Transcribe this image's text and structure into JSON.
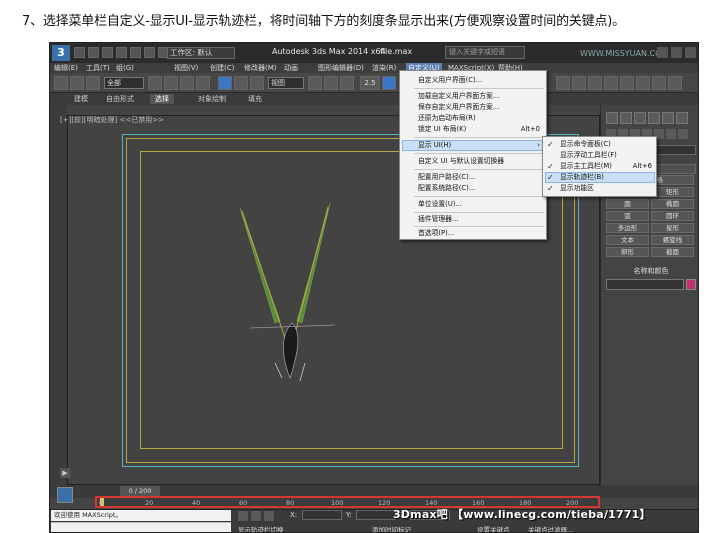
{
  "instruction": "7、选择菜单栏自定义-显示UI-显示轨迹栏，将时间轴下方的刻度条显示出来(方便观察设置时间的关键点)。",
  "titlebar": {
    "logo_text": "3",
    "workspace_label": "工作区: 默认",
    "app_title": "Autodesk 3ds Max  2014 x64",
    "file_name": "file.max",
    "search_placeholder": "键入关键字或短语",
    "site_watermark": "WWW.MISSYUAN.COM"
  },
  "menubar": {
    "items": [
      "编辑(E)",
      "工具(T)",
      "组(G)",
      "视图(V)",
      "创建(C)",
      "修改器(M)",
      "动画",
      "图形编辑器(D)",
      "渲染(R)",
      "自定义(U)",
      "MAXScript(X)",
      "帮助(H)"
    ]
  },
  "toolbar": {
    "selection_filter": "全部",
    "view_dropdown": "视图",
    "snap_label": "2.5"
  },
  "ribbon": {
    "tabs": [
      "建模",
      "自由形式",
      "选择",
      "对象绘制",
      "填充"
    ]
  },
  "viewport": {
    "label": "[+][前][明暗处理] <<已禁用>>",
    "play_symbol": "▶"
  },
  "customize_menu": {
    "items": [
      {
        "label": "自定义用户界面(C)..."
      },
      {
        "label": "加载自定义用户界面方案..."
      },
      {
        "label": "保存自定义用户界面方案..."
      },
      {
        "label": "还原为启动布局(R)"
      },
      {
        "label": "锁定 UI 布局(K)",
        "shortcut": "Alt+0"
      },
      {
        "label": "显示 UI(H)",
        "arrow": "›"
      },
      {
        "label": "自定义 UI 与默认设置切换器"
      },
      {
        "label": "配置用户路径(C)..."
      },
      {
        "label": "配置系统路径(C)..."
      },
      {
        "label": "单位设置(U)..."
      },
      {
        "label": "插件管理器..."
      },
      {
        "label": "首选项(P)..."
      }
    ]
  },
  "show_ui_submenu": {
    "check_mark": "✓",
    "items": [
      {
        "label": "显示命令面板(C)",
        "checked": true
      },
      {
        "label": "显示浮动工具栏(F)",
        "checked": false
      },
      {
        "label": "显示主工具栏(M)",
        "checked": true,
        "shortcut": "Alt+6"
      },
      {
        "label": "显示轨迹栏(B)",
        "checked": true
      },
      {
        "label": "显示功能区",
        "checked": true
      }
    ]
  },
  "command_panel": {
    "object_buttons": [
      "自动栅格",
      "线",
      "矩形",
      "圆",
      "椭圆",
      "弧",
      "圆环",
      "多边形",
      "星形",
      "文本",
      "螺旋线",
      "卵形",
      "截面"
    ],
    "name_color_label": "名称和颜色",
    "accent_color": "#c2306e"
  },
  "timeline": {
    "frame_label": "0 / 200",
    "ticks": [
      "0",
      "20",
      "40",
      "60",
      "80",
      "100",
      "120",
      "140",
      "160",
      "180",
      "200"
    ]
  },
  "statusbar": {
    "maxscript_label": "欢迎使用 MAXScript。",
    "coord_x": "X:",
    "coord_y": "Y:",
    "coord_z": "Z:",
    "hint1": "显示轨迹栏切换",
    "hint2": "添加时间标记",
    "hint3": "设置关键点",
    "hint4": "关键点过滤器...",
    "watermark": "3Dmax吧 【www.linecg.com/tieba/1771】"
  },
  "colors": {
    "highlight": "#c9dff5",
    "trackbar_border": "#d93530",
    "frame_cyan": "#4fb7c0",
    "frame_yellow": "#b8a844"
  }
}
